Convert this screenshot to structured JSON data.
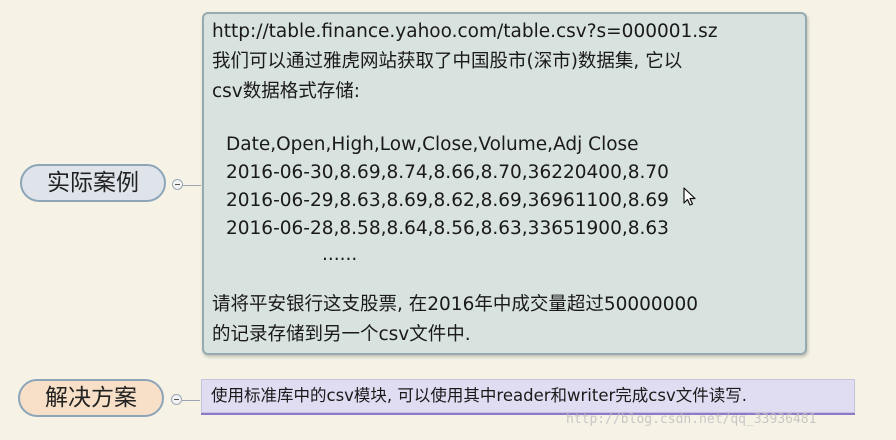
{
  "mindmap": {
    "case_node": {
      "label": "实际案例",
      "content": {
        "url": "http://table.finance.yahoo.com/table.csv?s=000001.sz",
        "description_line1": "我们可以通过雅虎网站获取了中国股市(深市)数据集, 它以",
        "description_line2": "csv数据格式存储:",
        "csv_header": "Date,Open,High,Low,Close,Volume,Adj Close",
        "csv_rows": [
          "2016-06-30,8.69,8.74,8.66,8.70,36220400,8.70",
          "2016-06-29,8.63,8.69,8.62,8.69,36961100,8.69",
          "2016-06-28,8.58,8.64,8.56,8.63,33651900,8.63"
        ],
        "ellipsis": "......",
        "task_line1": "请将平安银行这支股票, 在2016年中成交量超过50000000",
        "task_line2": "的记录存储到另一个csv文件中."
      }
    },
    "solution_node": {
      "label": "解决方案",
      "content": "使用标准库中的csv模块, 可以使用其中reader和writer完成csv文件读写."
    }
  },
  "watermark": "http://blog.csdn.net/qq_33936481",
  "colors": {
    "background": "#f6f3e6",
    "case_pill": "#dfe4eb",
    "solution_pill": "#f8dfc7",
    "content_box": "#d8e2de",
    "solution_box": "#e0dcf2",
    "solution_underline": "#8b7bc8"
  }
}
